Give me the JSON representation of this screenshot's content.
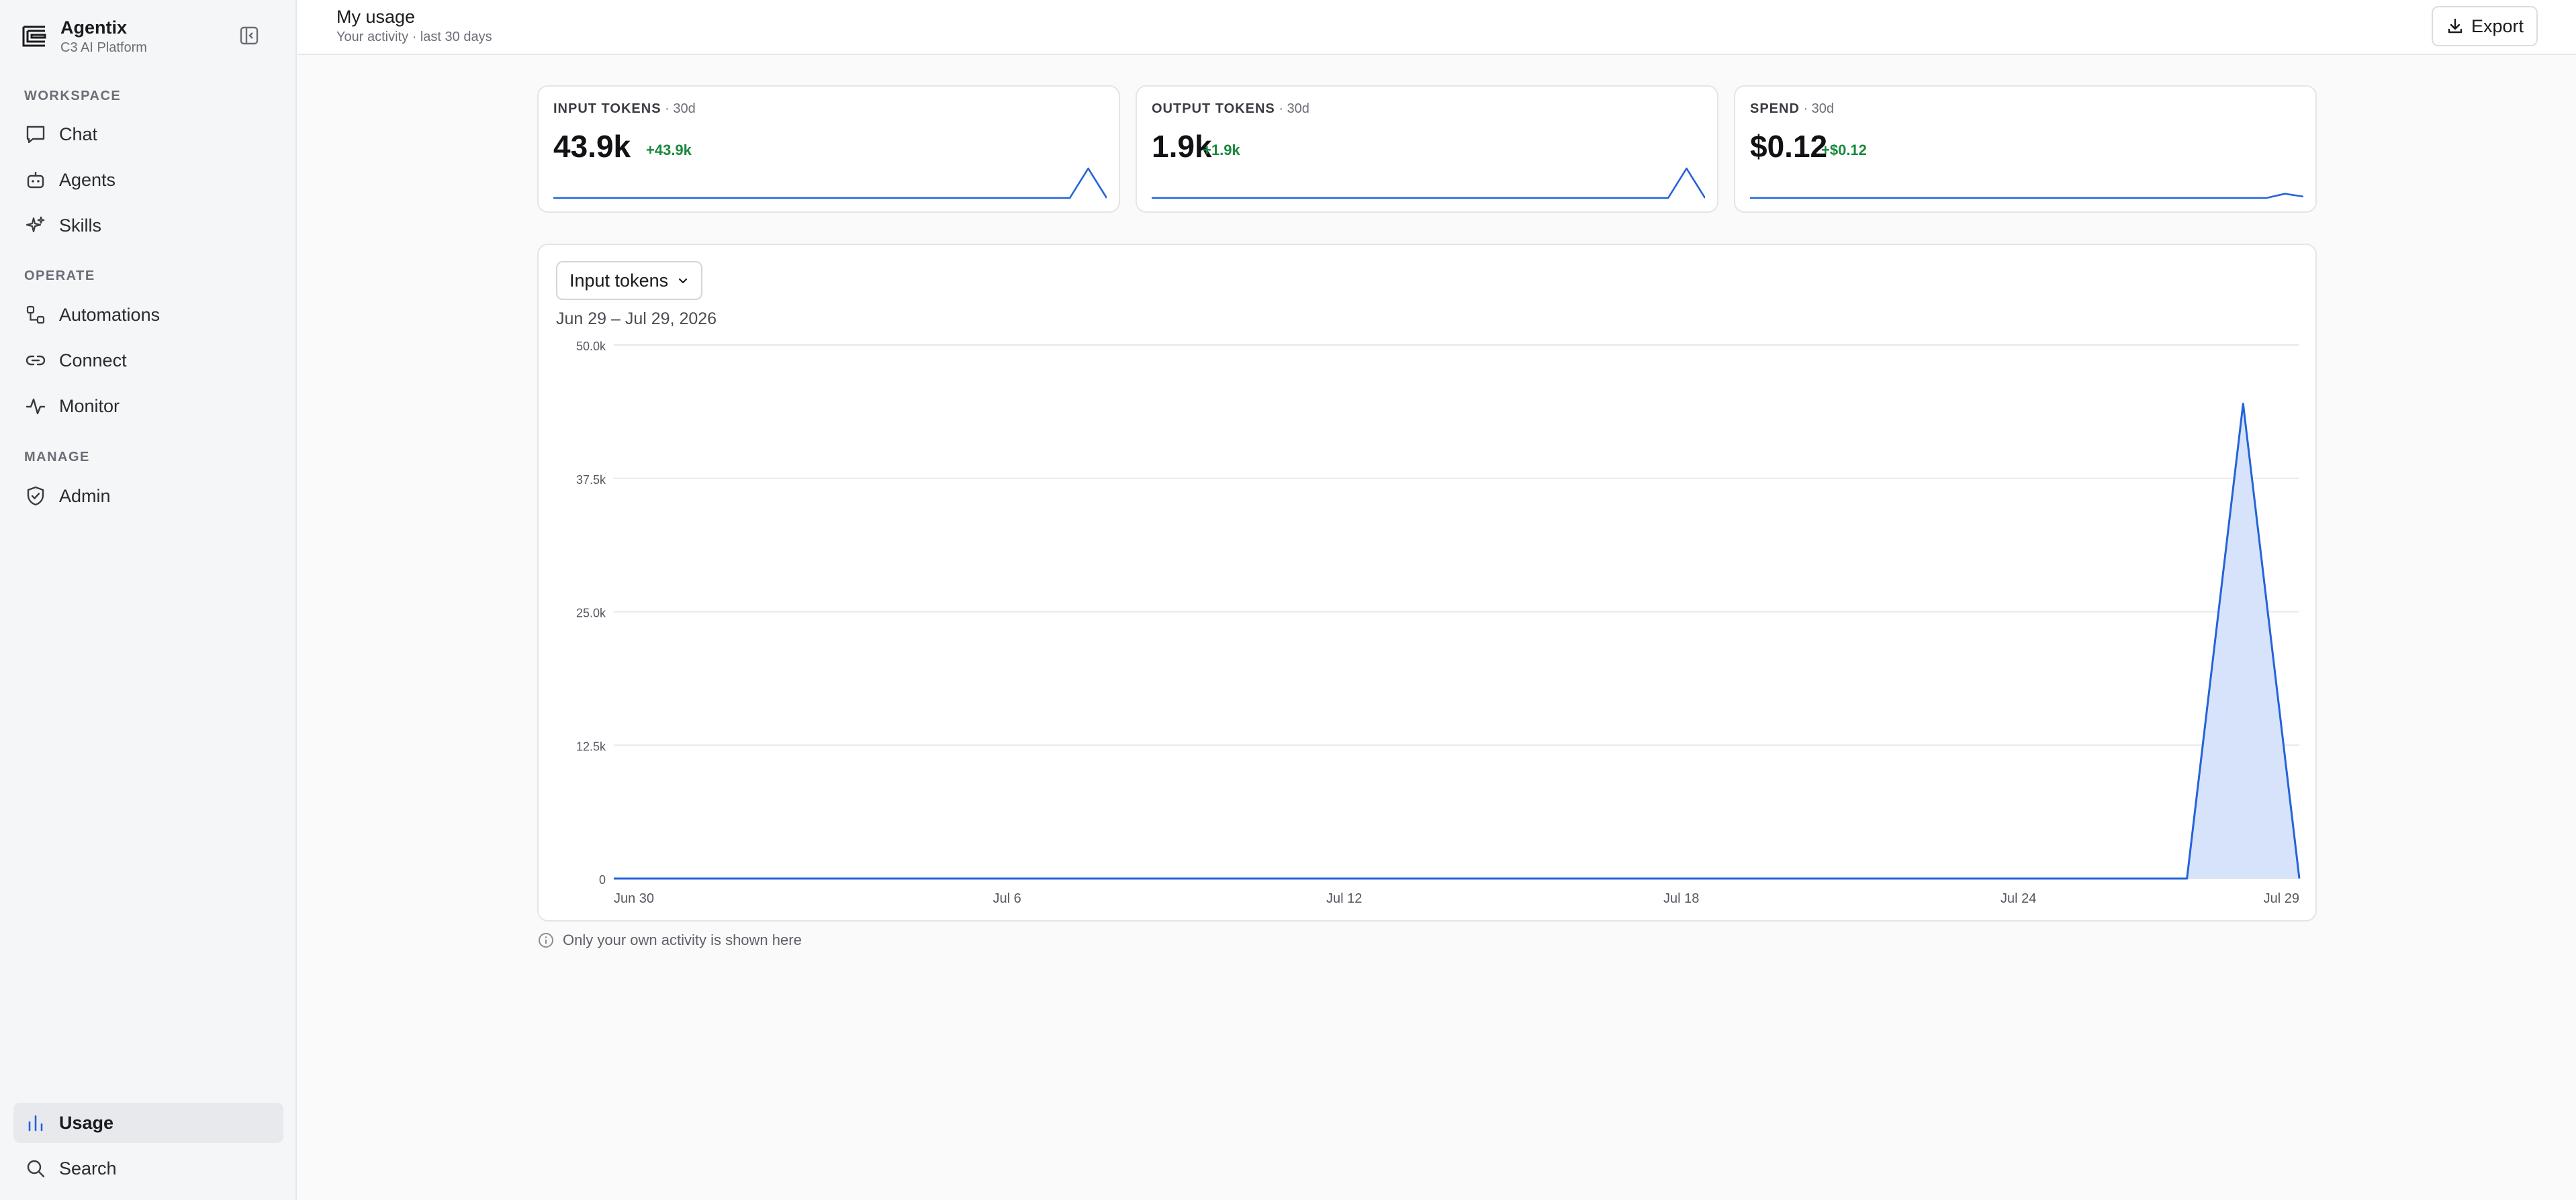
{
  "app": {
    "name": "Agentix",
    "subtitle": "C3 AI Platform"
  },
  "sidebar": {
    "sections": [
      {
        "label": "WORKSPACE",
        "items": [
          {
            "label": "Chat",
            "icon": "chat-bubble-icon"
          },
          {
            "label": "Agents",
            "icon": "robot-icon"
          },
          {
            "label": "Skills",
            "icon": "sparkles-icon"
          }
        ]
      },
      {
        "label": "OPERATE",
        "items": [
          {
            "label": "Automations",
            "icon": "workflow-icon"
          },
          {
            "label": "Connect",
            "icon": "link-icon"
          },
          {
            "label": "Monitor",
            "icon": "activity-icon"
          }
        ]
      },
      {
        "label": "MANAGE",
        "items": [
          {
            "label": "Admin",
            "icon": "shield-check-icon"
          }
        ]
      }
    ],
    "bottom": [
      {
        "label": "Usage",
        "icon": "bar-chart-icon",
        "active": true
      },
      {
        "label": "Search",
        "icon": "search-icon"
      }
    ]
  },
  "header": {
    "title": "My usage",
    "subtitle": "Your activity · last 30 days",
    "export_label": "Export"
  },
  "stats": [
    {
      "key": "INPUT TOKENS",
      "period": " · 30d",
      "value": "43.9k",
      "delta": "+43.9k"
    },
    {
      "key": "OUTPUT TOKENS",
      "period": " · 30d",
      "value": "1.9k",
      "delta": "+1.9k"
    },
    {
      "key": "SPEND",
      "period": " · 30d",
      "value": "$0.12",
      "delta": "+$0.12"
    }
  ],
  "chart": {
    "metric_selected": "Input tokens",
    "date_range": "Jun 29 – Jul 29, 2026"
  },
  "footnote": "Only your own activity is shown here",
  "colors": {
    "accent": "#2563d9",
    "area_fill": "#d6e3fa",
    "delta_positive": "#19883e"
  },
  "chart_data": {
    "type": "area",
    "x": [
      "Jun 29",
      "Jun 30",
      "Jul 1",
      "Jul 2",
      "Jul 3",
      "Jul 4",
      "Jul 5",
      "Jul 6",
      "Jul 7",
      "Jul 8",
      "Jul 9",
      "Jul 10",
      "Jul 11",
      "Jul 12",
      "Jul 13",
      "Jul 14",
      "Jul 15",
      "Jul 16",
      "Jul 17",
      "Jul 18",
      "Jul 19",
      "Jul 20",
      "Jul 21",
      "Jul 22",
      "Jul 23",
      "Jul 24",
      "Jul 25",
      "Jul 26",
      "Jul 27",
      "Jul 28",
      "Jul 29"
    ],
    "series": [
      {
        "values": [
          0,
          0,
          0,
          0,
          0,
          0,
          0,
          0,
          0,
          0,
          0,
          0,
          0,
          0,
          0,
          0,
          0,
          0,
          0,
          0,
          0,
          0,
          0,
          0,
          0,
          0,
          0,
          0,
          0,
          44500,
          0
        ]
      }
    ],
    "xticks": [
      "Jun 30",
      "Jul 6",
      "Jul 12",
      "Jul 18",
      "Jul 24",
      "Jul 29"
    ],
    "yticks": [
      "0",
      "12.5k",
      "25.0k",
      "37.5k",
      "50.0k"
    ],
    "ylim": [
      0,
      50000
    ],
    "grid": true,
    "sparklines": {
      "input_tokens": [
        0,
        0,
        0,
        0,
        0,
        0,
        0,
        0,
        0,
        0,
        0,
        0,
        0,
        0,
        0,
        0,
        0,
        0,
        0,
        0,
        0,
        0,
        0,
        0,
        0,
        0,
        0,
        0,
        0,
        43900,
        0
      ],
      "output_tokens": [
        0,
        0,
        0,
        0,
        0,
        0,
        0,
        0,
        0,
        0,
        0,
        0,
        0,
        0,
        0,
        0,
        0,
        0,
        0,
        0,
        0,
        0,
        0,
        0,
        0,
        0,
        0,
        0,
        0,
        1900,
        0
      ],
      "spend": [
        0,
        0,
        0,
        0,
        0,
        0,
        0,
        0,
        0,
        0,
        0,
        0,
        0,
        0,
        0,
        0,
        0,
        0,
        0,
        0,
        0,
        0,
        0,
        0,
        0,
        0,
        0,
        0,
        0,
        0.12,
        0.04
      ]
    }
  }
}
